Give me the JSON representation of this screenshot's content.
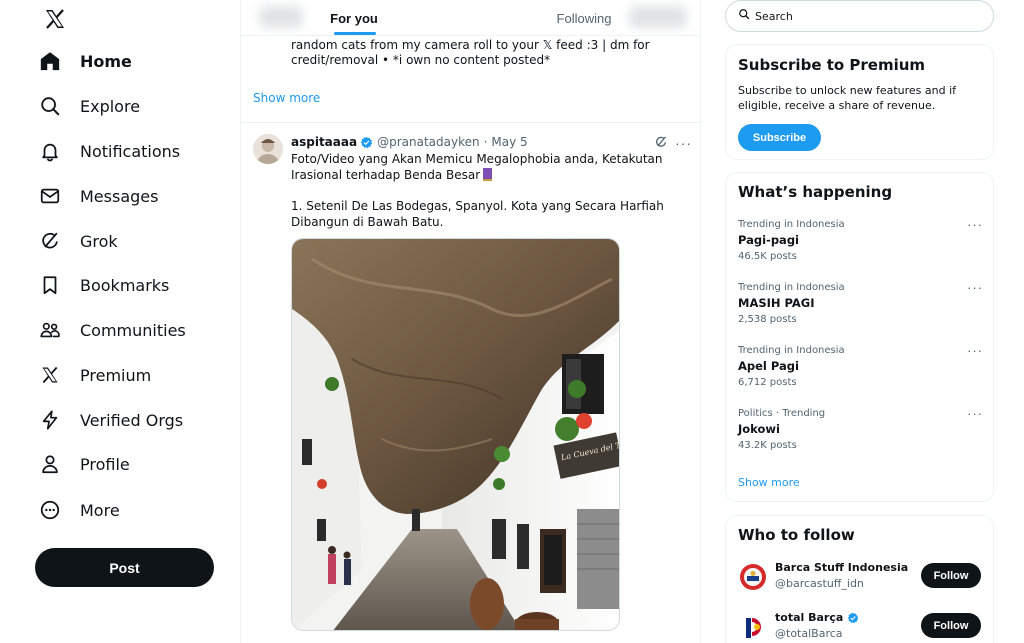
{
  "sidebar": {
    "logo_icon": "x-logo-icon",
    "items": [
      {
        "label": "Home",
        "icon": "home-icon",
        "active": true
      },
      {
        "label": "Explore",
        "icon": "search-icon"
      },
      {
        "label": "Notifications",
        "icon": "bell-icon"
      },
      {
        "label": "Messages",
        "icon": "envelope-icon"
      },
      {
        "label": "Grok",
        "icon": "grok-icon"
      },
      {
        "label": "Bookmarks",
        "icon": "bookmark-icon"
      },
      {
        "label": "Communities",
        "icon": "people-icon"
      },
      {
        "label": "Premium",
        "icon": "x-logo-icon"
      },
      {
        "label": "Verified Orgs",
        "icon": "lightning-icon"
      },
      {
        "label": "Profile",
        "icon": "person-icon"
      },
      {
        "label": "More",
        "icon": "more-circle-icon"
      }
    ],
    "post_label": "Post"
  },
  "feed": {
    "tabs": [
      {
        "label": "For you",
        "active": true
      },
      {
        "label": "Following",
        "active": false
      }
    ],
    "previous_post": {
      "bio_text": "random cats from my camera roll to your 𝕏 feed :3 | dm for credit/removal • *i own no content posted*",
      "show_more_label": "Show more"
    },
    "tweet": {
      "name": "aspitaaaa",
      "handle": "@pranatadayken",
      "separator": "·",
      "date": "May 5",
      "text_lines": [
        "Foto/Video yang Akan Memicu Megalophobia anda, Ketakutan Irasional terhadap Benda Besar",
        "1. Setenil De Las Bodegas, Spanyol. Kota yang Secara Harfiah Dibangun di Bawah Batu."
      ],
      "shop_sign": "La Cueva del Tuerto",
      "more_icon": "more-horizontal-icon",
      "grok_icon": "grok-icon"
    }
  },
  "right": {
    "search": {
      "placeholder": "Search"
    },
    "premium": {
      "title": "Subscribe to Premium",
      "text": "Subscribe to unlock new features and if eligible, receive a share of revenue.",
      "button_label": "Subscribe"
    },
    "trending": {
      "title": "What’s happening",
      "items": [
        {
          "context": "Trending in Indonesia",
          "topic": "Pagi-pagi",
          "count": "46.5K posts"
        },
        {
          "context": "Trending in Indonesia",
          "topic": "MASIH PAGI",
          "count": "2,538 posts"
        },
        {
          "context": "Trending in Indonesia",
          "topic": "Apel Pagi",
          "count": "6,712 posts"
        },
        {
          "context": "Politics · Trending",
          "topic": "Jokowi",
          "count": "43.2K posts"
        }
      ],
      "show_more_label": "Show more"
    },
    "who_to_follow": {
      "title": "Who to follow",
      "accounts": [
        {
          "name": "Barca Stuff Indonesia",
          "handle": "@barcastuff_idn",
          "verified": false,
          "button_label": "Follow"
        },
        {
          "name": "total Barça",
          "handle": "@totalBarca",
          "verified": true,
          "button_label": "Follow"
        }
      ]
    }
  },
  "colors": {
    "accent": "#1d9bf0",
    "text": "#0f1419",
    "muted": "#536471",
    "border": "#eff3f4",
    "dark_button": "#0f1419"
  }
}
